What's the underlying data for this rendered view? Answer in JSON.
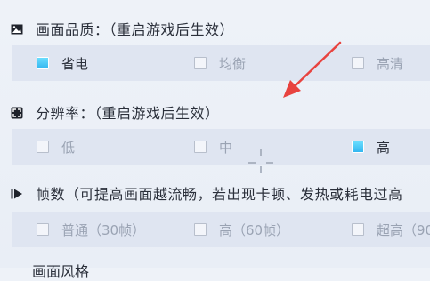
{
  "sections": [
    {
      "icon": "image-quality-icon",
      "title": "画面品质：（重启游戏后生效）",
      "options": [
        {
          "label": "省电",
          "selected": true
        },
        {
          "label": "均衡",
          "selected": false
        },
        {
          "label": "高清",
          "selected": false
        }
      ]
    },
    {
      "icon": "resolution-icon",
      "title": "分辨率：（重启游戏后生效）",
      "options": [
        {
          "label": "低",
          "selected": false
        },
        {
          "label": "中",
          "selected": false
        },
        {
          "label": "高",
          "selected": true
        }
      ]
    },
    {
      "icon": "frame-rate-icon",
      "title": "帧数（可提高画面越流畅，若出现卡顿、发热或耗电过高",
      "options": [
        {
          "label": "普通（30帧）",
          "selected": false
        },
        {
          "label": "高（60帧）",
          "selected": false
        },
        {
          "label": "超高（90",
          "selected": false
        }
      ]
    }
  ],
  "partial_next_title": "画面风格",
  "colors": {
    "selected_fill": "#2fb3ef",
    "arrow": "#e8433f",
    "row_bg": "#dfe5f1"
  }
}
